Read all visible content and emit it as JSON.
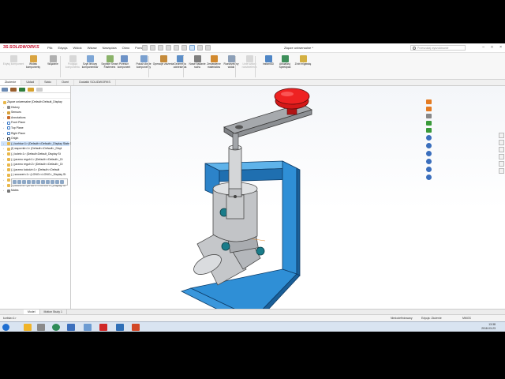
{
  "app": {
    "logo": "SOLIDWORKS",
    "menus": [
      "Plik",
      "Edycja",
      "Widok",
      "Wstaw",
      "Narzędzia",
      "Okno",
      "Pomoc"
    ],
    "doc_title": "Złącze uniwersalne *",
    "search_placeholder": "Przeszukaj wyszukiwanie"
  },
  "ribbon": {
    "buttons": [
      {
        "label": "Edytuj komponent",
        "dim": true
      },
      {
        "label": "Wstaw komponenty",
        "dim": false
      },
      {
        "label": "Wiązanie",
        "dim": false
      },
      {
        "label": "Podgląd komponentu",
        "dim": true
      },
      {
        "label": "Szyk liniowy komponentów",
        "dim": false
      },
      {
        "label": "Szybkie Smart Fasteners",
        "dim": false
      },
      {
        "label": "Przesuń komponent",
        "dim": false
      },
      {
        "label": "Pokaż ukryte komponenty",
        "dim": false
      },
      {
        "label": "Operacje złożenia",
        "dim": false
      },
      {
        "label": "Geometria odniesienia",
        "dim": false
      },
      {
        "label": "Nowe badanie ruchu",
        "dim": false
      },
      {
        "label": "Zestawienie materiałów",
        "dim": false
      },
      {
        "label": "Rozstrzelony widok",
        "dim": false
      },
      {
        "label": "Linie szkicu rozstrzelenia",
        "dim": true
      },
      {
        "label": "Instant3D",
        "dim": false
      },
      {
        "label": "Aktualizuj Speedpak",
        "dim": false
      },
      {
        "label": "Zrób migawkę",
        "dim": false
      }
    ]
  },
  "tabs": [
    "Złożenie",
    "Układ",
    "Szkic",
    "Oceń",
    "Dodatki SOLIDWORKS"
  ],
  "tree": {
    "root": "Złącze uniwersalne (Default<Default_Display",
    "items": [
      {
        "label": "History",
        "icon": "hist",
        "lvl": 1
      },
      {
        "label": "Sensors",
        "icon": "sens",
        "lvl": 1
      },
      {
        "label": "Annotations",
        "icon": "ann",
        "lvl": 1
      },
      {
        "label": "Front Plane",
        "icon": "plane",
        "lvl": 1
      },
      {
        "label": "Top Plane",
        "icon": "plane",
        "lvl": 1
      },
      {
        "label": "Right Plane",
        "icon": "plane",
        "lvl": 1
      },
      {
        "label": "Origin",
        "icon": "orig",
        "lvl": 1
      },
      {
        "label": "(-) korbka<1> (Default<<Default>_Display State 1>)",
        "icon": "part",
        "lvl": 1,
        "sel": true
      },
      {
        "label": "(f) wspornik<1> (Default<<Default>_Displ",
        "icon": "part",
        "lvl": 1
      },
      {
        "label": "(-) kolek<1> (Default<Default_Display St",
        "icon": "part",
        "lvl": 1
      },
      {
        "label": "(-) jarzmo reguł<1> (Default<<Default>_Di",
        "icon": "part",
        "lvl": 1
      },
      {
        "label": "(-) jarzmo reguł<2> (Default<<Default>_Di",
        "icon": "part",
        "lvl": 1
      },
      {
        "label": "(-) jarzmo kolodzi<1> (Default<<Default",
        "icon": "part",
        "lvl": 1
      },
      {
        "label": "(-) sworzeń<1> (LONG<<LONG>_Display St",
        "icon": "part",
        "lvl": 1
      },
      {
        "label": "(-) kolek<1> (SHORT<<SHORT>_Display St",
        "icon": "part",
        "lvl": 1
      },
      {
        "label": "(-) kolek<2> (SHORT<<SHORT>_Display St",
        "icon": "part",
        "lvl": 1
      },
      {
        "label": "Mates",
        "icon": "mate",
        "lvl": 1
      }
    ]
  },
  "bottom_tabs": [
    "Model",
    "Motion Study 1"
  ],
  "status": {
    "left": "korbka<1>",
    "state1": "Niedodefiniowany",
    "state2": "Edycja: Złożenie",
    "units": "MMGS"
  },
  "tray": {
    "time": "13:38",
    "date": "2018-03-23"
  },
  "colors": {
    "bracket": "#2f8fd6",
    "knob": "#e01b1b",
    "steel": "#b9bbbe",
    "accent": "#c8102e"
  }
}
